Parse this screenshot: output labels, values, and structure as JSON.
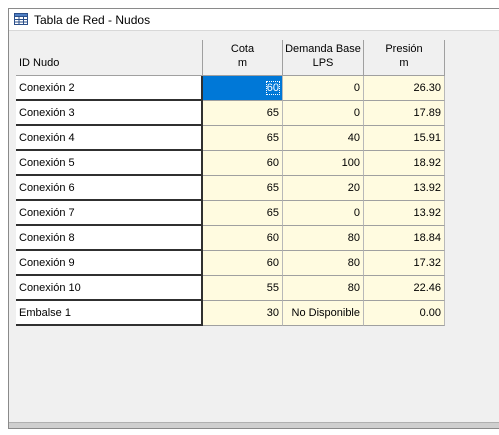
{
  "window": {
    "title": "Tabla de Red - Nudos",
    "icon": "table-grid-icon"
  },
  "table": {
    "columns": [
      {
        "line1": "ID Nudo",
        "line2": ""
      },
      {
        "line1": "Cota",
        "line2": "m"
      },
      {
        "line1": "Demanda Base",
        "line2": "LPS"
      },
      {
        "line1": "Presión",
        "line2": "m"
      }
    ],
    "rows": [
      {
        "id": "Conexión 2",
        "cota": "60",
        "demanda": "0",
        "presion": "26.30"
      },
      {
        "id": "Conexión 3",
        "cota": "65",
        "demanda": "0",
        "presion": "17.89"
      },
      {
        "id": "Conexión 4",
        "cota": "65",
        "demanda": "40",
        "presion": "15.91"
      },
      {
        "id": "Conexión 5",
        "cota": "60",
        "demanda": "100",
        "presion": "18.92"
      },
      {
        "id": "Conexión 6",
        "cota": "65",
        "demanda": "20",
        "presion": "13.92"
      },
      {
        "id": "Conexión 7",
        "cota": "65",
        "demanda": "0",
        "presion": "13.92"
      },
      {
        "id": "Conexión 8",
        "cota": "60",
        "demanda": "80",
        "presion": "18.84"
      },
      {
        "id": "Conexión 9",
        "cota": "60",
        "demanda": "80",
        "presion": "17.32"
      },
      {
        "id": "Conexión 10",
        "cota": "55",
        "demanda": "80",
        "presion": "22.46"
      },
      {
        "id": "Embalse 1",
        "cota": "30",
        "demanda": "No Disponible",
        "presion": "0.00"
      }
    ],
    "selected_row": 0,
    "selected_column": "cota"
  },
  "colors": {
    "value_cell_bg": "#fffbe0",
    "selection_bg": "#0078d7",
    "window_bg": "#f0f0f0"
  }
}
